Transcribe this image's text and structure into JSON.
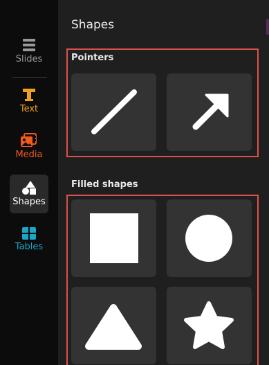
{
  "sidebar": {
    "items": [
      {
        "label": "Slides",
        "icon": "slides-icon",
        "color": "#9a9a9a"
      },
      {
        "label": "Text",
        "icon": "text-icon",
        "color": "#f0a11b"
      },
      {
        "label": "Media",
        "icon": "media-icon",
        "color": "#f25a1e"
      },
      {
        "label": "Shapes",
        "icon": "shapes-icon",
        "color": "#ffffff",
        "active": true
      },
      {
        "label": "Tables",
        "icon": "tables-icon",
        "color": "#1aa6c8"
      }
    ]
  },
  "panel": {
    "title": "Shapes",
    "sections": [
      {
        "title": "Pointers",
        "items": [
          {
            "name": "line-shape"
          },
          {
            "name": "arrow-shape"
          }
        ]
      },
      {
        "title": "Filled shapes",
        "items": [
          {
            "name": "square-shape"
          },
          {
            "name": "circle-shape"
          },
          {
            "name": "triangle-shape"
          },
          {
            "name": "star-shape"
          }
        ]
      }
    ]
  },
  "colors": {
    "highlight": "#e0504a",
    "tile": "#333333",
    "panel": "#1f1f1f",
    "rail": "#0c0c0c"
  }
}
